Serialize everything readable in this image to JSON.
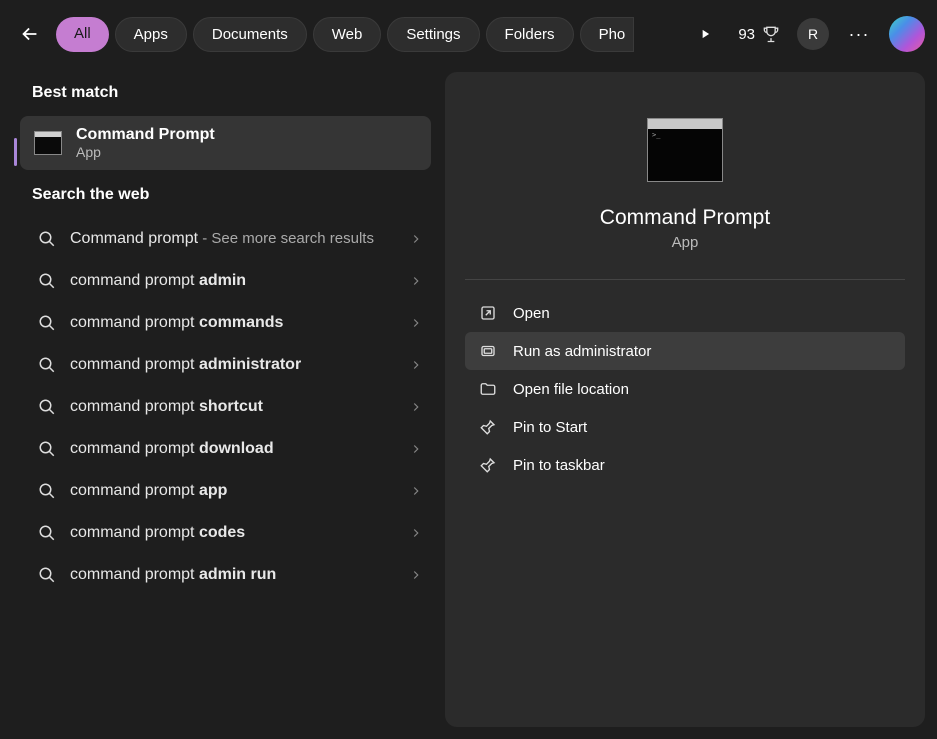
{
  "topbar": {
    "tabs": [
      "All",
      "Apps",
      "Documents",
      "Web",
      "Settings",
      "Folders",
      "Pho"
    ],
    "active_tab_index": 0,
    "points": "93",
    "avatar_initial": "R"
  },
  "left": {
    "best_match_header": "Best match",
    "best_match": {
      "title": "Command Prompt",
      "subtitle": "App"
    },
    "web_header": "Search the web",
    "web_results": [
      {
        "base": "Command prompt",
        "bold": "",
        "extra": " - See more search results"
      },
      {
        "base": "command prompt ",
        "bold": "admin",
        "extra": ""
      },
      {
        "base": "command prompt ",
        "bold": "commands",
        "extra": ""
      },
      {
        "base": "command prompt ",
        "bold": "administrator",
        "extra": ""
      },
      {
        "base": "command prompt ",
        "bold": "shortcut",
        "extra": ""
      },
      {
        "base": "command prompt ",
        "bold": "download",
        "extra": ""
      },
      {
        "base": "command prompt ",
        "bold": "app",
        "extra": ""
      },
      {
        "base": "command prompt ",
        "bold": "codes",
        "extra": ""
      },
      {
        "base": "command prompt ",
        "bold": "admin run",
        "extra": ""
      }
    ]
  },
  "right": {
    "title": "Command Prompt",
    "subtitle": "App",
    "actions": [
      {
        "icon": "open",
        "label": "Open",
        "hover": false
      },
      {
        "icon": "shield",
        "label": "Run as administrator",
        "hover": true
      },
      {
        "icon": "folder",
        "label": "Open file location",
        "hover": false
      },
      {
        "icon": "pin",
        "label": "Pin to Start",
        "hover": false
      },
      {
        "icon": "pin",
        "label": "Pin to taskbar",
        "hover": false
      }
    ]
  }
}
